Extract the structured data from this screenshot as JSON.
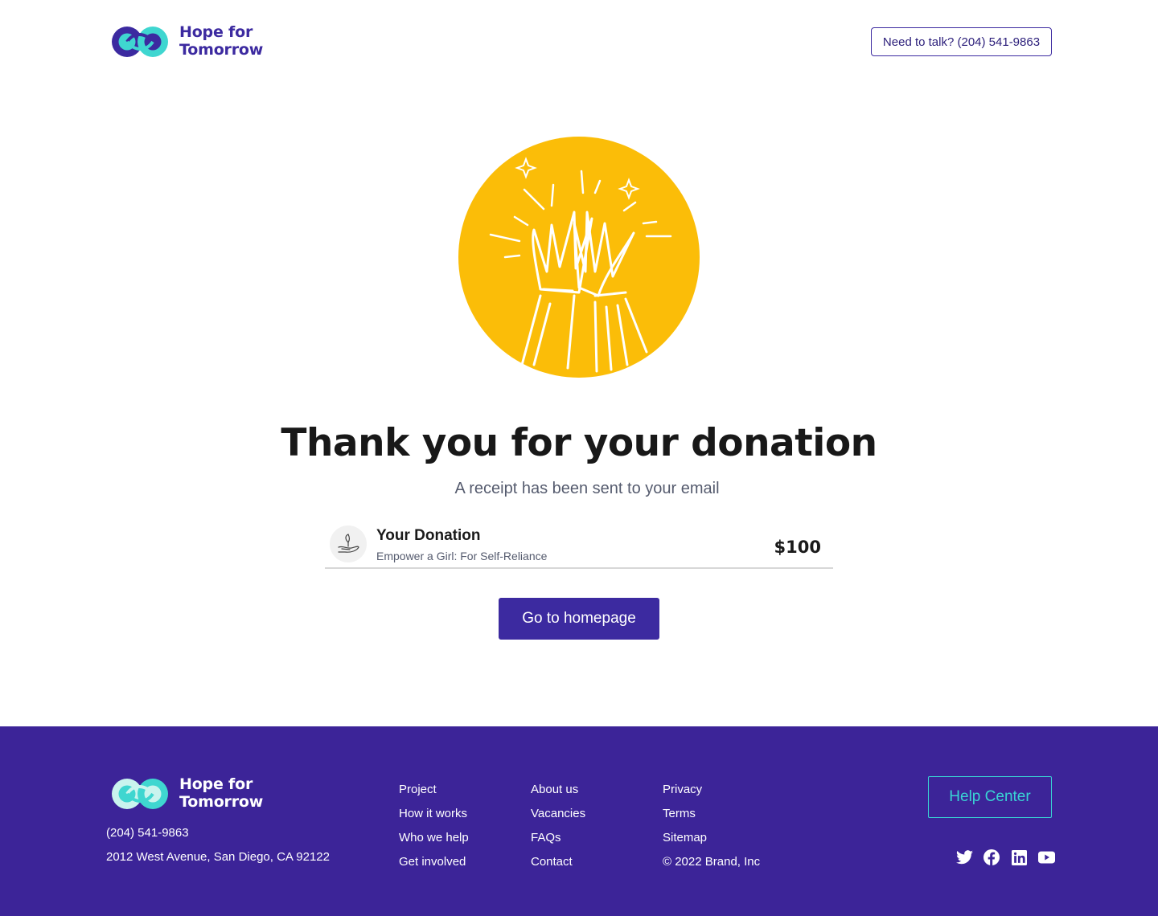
{
  "header": {
    "logo_text_line1": "Hope for",
    "logo_text_line2": "Tomorrow",
    "talk_button": "Need to talk? (204) 541-9863"
  },
  "hero": {
    "illustration_icon": "high-five-illustration",
    "title": "Thank you for your donation",
    "subtitle": "A receipt has been sent to your email"
  },
  "donation": {
    "icon": "hand-plant-icon",
    "title": "Your Donation",
    "subtitle": "Empower a Girl: For Self-Reliance",
    "amount": "$100"
  },
  "cta": {
    "home_button": "Go to homepage"
  },
  "footer": {
    "logo_text_line1": "Hope for",
    "logo_text_line2": "Tomorrow",
    "phone": "(204) 541-9863",
    "address": "2012 West Avenue, San Diego, CA 92122",
    "columns": [
      {
        "links": [
          "Project",
          "How it works",
          "Who we help",
          "Get involved"
        ]
      },
      {
        "links": [
          "About us",
          "Vacancies",
          "FAQs",
          "Contact"
        ]
      },
      {
        "links": [
          "Privacy",
          "Terms",
          "Sitemap"
        ],
        "copyright": "© 2022 Brand, Inc"
      }
    ],
    "help_button": "Help Center",
    "socials": [
      "twitter-icon",
      "facebook-icon",
      "linkedin-icon",
      "youtube-icon"
    ]
  },
  "colors": {
    "brand_purple": "#3c2aa0",
    "footer_bg": "#3c2498",
    "accent_teal": "#39d4d4",
    "accent_yellow": "#fbbd08"
  }
}
